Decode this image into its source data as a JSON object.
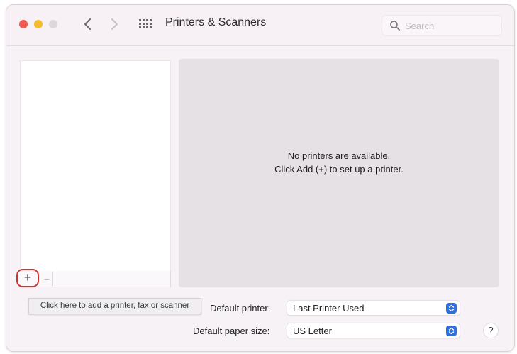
{
  "window": {
    "title": "Printers & Scanners",
    "search": {
      "placeholder": "Search"
    }
  },
  "toolbar": {
    "back_icon": "chevron-left-icon",
    "forward_icon": "chevron-right-icon",
    "grid_icon": "grid-icon"
  },
  "printer_list": {
    "add_label": "+",
    "remove_label": "−",
    "add_tooltip": "Click here to add a printer, fax or scanner"
  },
  "detail": {
    "empty_line1": "No printers are available.",
    "empty_line2": "Click Add (+) to set up a printer."
  },
  "settings": {
    "default_printer_label": "Default printer:",
    "default_printer_value": "Last Printer Used",
    "paper_size_label": "Default paper size:",
    "paper_size_value": "US Letter"
  },
  "help": {
    "label": "?"
  },
  "colors": {
    "close": "#ee5a50",
    "minimize": "#f3bb2e",
    "accent": "#2e6fe0",
    "highlight": "#d23232"
  }
}
